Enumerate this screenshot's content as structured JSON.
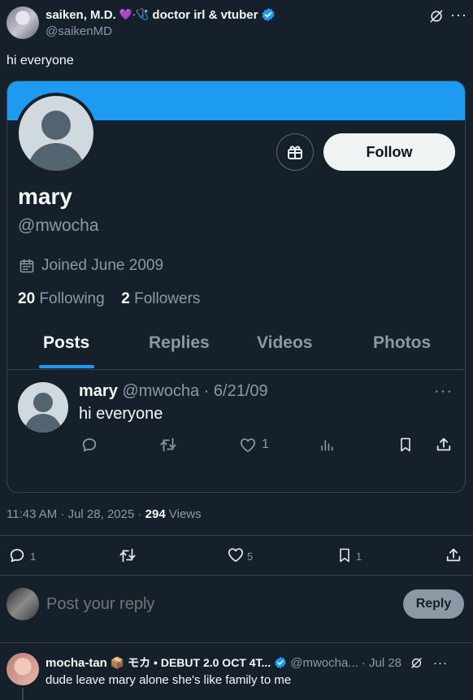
{
  "tweet": {
    "author_name": "saiken, M.D.",
    "author_decor": "💜·🩺",
    "author_tagline": "doctor irl & vtuber",
    "author_handle": "@saikenMD",
    "text": "hi everyone",
    "timestamp": "11:43 AM · Jul 28, 2025 ·",
    "views_count": "294",
    "views_label": "Views",
    "replies": "1",
    "retweets": "",
    "likes": "5",
    "bookmarks": "1"
  },
  "card": {
    "follow_label": "Follow",
    "name": "mary",
    "handle": "@mwocha",
    "joined": "Joined June 2009",
    "following_count": "20",
    "following_label": "Following",
    "followers_count": "2",
    "followers_label": "Followers",
    "tabs": [
      "Posts",
      "Replies",
      "Videos",
      "Photos"
    ],
    "inner_tweet": {
      "name": "mary",
      "handle_date": "@mwocha · 6/21/09",
      "text": "hi everyone",
      "likes": "1",
      "more": "···"
    }
  },
  "reply_box": {
    "placeholder": "Post your reply",
    "button": "Reply"
  },
  "reply": {
    "author_name": "mocha-tan",
    "author_decor": "📦 モカ • DEBUT 2.0 OCT 4T...",
    "handle": "@mwocha...",
    "date": "· Jul 28",
    "text": "dude leave mary alone she's like family to me"
  },
  "colors": {
    "accent": "#1d9bf0",
    "background": "#15202b",
    "muted": "#8b98a5"
  }
}
